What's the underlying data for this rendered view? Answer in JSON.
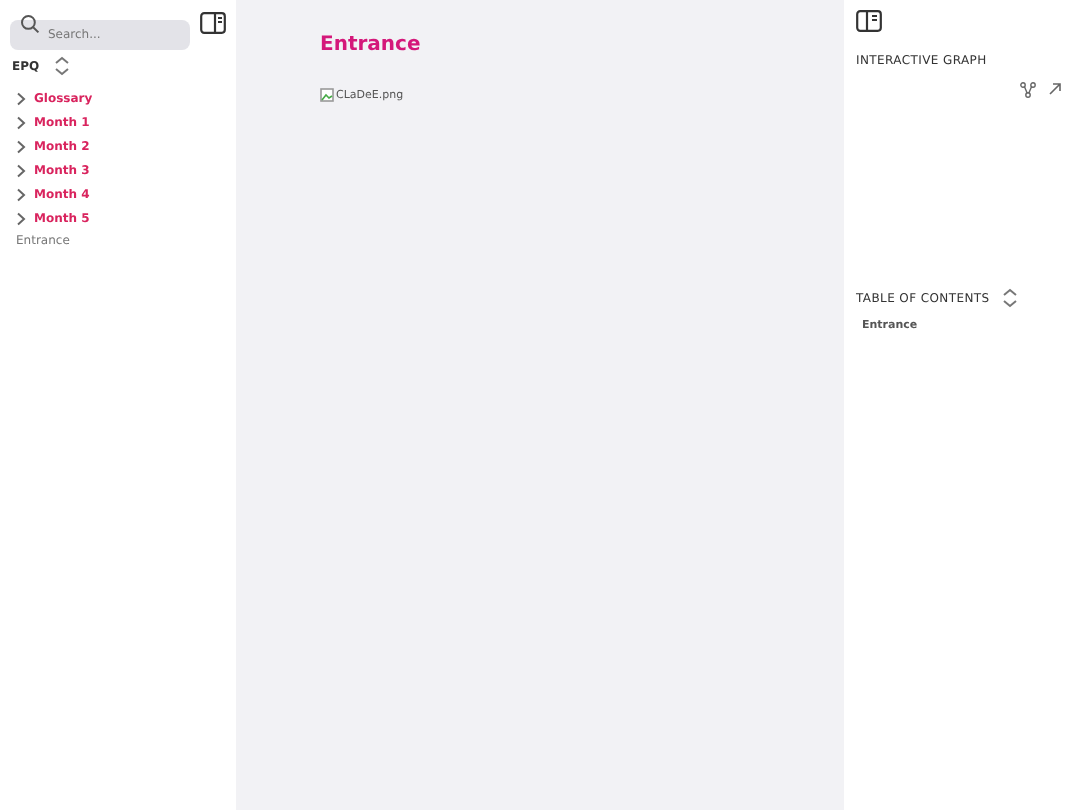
{
  "sidebar": {
    "search": {
      "placeholder": "Search..."
    },
    "vault": "EPQ",
    "items": [
      {
        "kind": "folder",
        "label": "Glossary",
        "expanded": false
      },
      {
        "kind": "folder",
        "label": "Month 1",
        "expanded": false
      },
      {
        "kind": "folder",
        "label": "Month 2",
        "expanded": false
      },
      {
        "kind": "folder",
        "label": "Month 3",
        "expanded": false
      },
      {
        "kind": "folder",
        "label": "Month 4",
        "expanded": false
      },
      {
        "kind": "folder",
        "label": "Month 5",
        "expanded": false
      },
      {
        "kind": "file",
        "label": "Entrance"
      }
    ]
  },
  "page": {
    "title": "Entrance",
    "image_alt": "CLaDeE.png"
  },
  "right": {
    "graph_title": "INTERACTIVE GRAPH",
    "toc_title": "TABLE OF CONTENTS",
    "toc": [
      "Entrance"
    ]
  }
}
